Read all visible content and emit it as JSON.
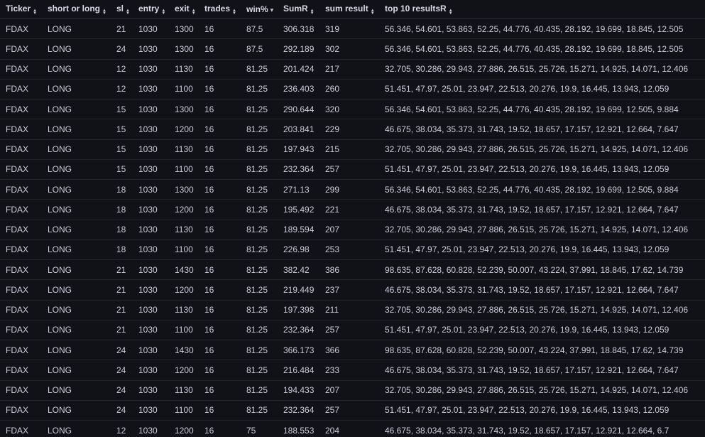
{
  "columns": [
    {
      "label": "Ticker",
      "sort_icon": "sort-both-icon",
      "sorted": false
    },
    {
      "label": "short or long",
      "sort_icon": "sort-both-icon",
      "sorted": false
    },
    {
      "label": "sl",
      "sort_icon": "sort-both-icon",
      "sorted": false
    },
    {
      "label": "entry",
      "sort_icon": "sort-both-icon",
      "sorted": false
    },
    {
      "label": "exit",
      "sort_icon": "sort-both-icon",
      "sorted": false
    },
    {
      "label": "trades",
      "sort_icon": "sort-both-icon",
      "sorted": false
    },
    {
      "label": "win%",
      "sort_icon": "sort-descending-icon",
      "sorted": true
    },
    {
      "label": "SumR",
      "sort_icon": "sort-both-icon",
      "sorted": false
    },
    {
      "label": "sum result",
      "sort_icon": "sort-both-icon",
      "sorted": false
    },
    {
      "label": "top 10 resultsR",
      "sort_icon": "sort-both-icon",
      "sorted": false
    }
  ],
  "rows": [
    [
      "FDAX",
      "LONG",
      "21",
      "1030",
      "1300",
      "16",
      "87.5",
      "306.318",
      "319",
      "56.346, 54.601, 53.863, 52.25, 44.776, 40.435, 28.192, 19.699, 18.845, 12.505"
    ],
    [
      "FDAX",
      "LONG",
      "24",
      "1030",
      "1300",
      "16",
      "87.5",
      "292.189",
      "302",
      "56.346, 54.601, 53.863, 52.25, 44.776, 40.435, 28.192, 19.699, 18.845, 12.505"
    ],
    [
      "FDAX",
      "LONG",
      "12",
      "1030",
      "1130",
      "16",
      "81.25",
      "201.424",
      "217",
      "32.705, 30.286, 29.943, 27.886, 26.515, 25.726, 15.271, 14.925, 14.071, 12.406"
    ],
    [
      "FDAX",
      "LONG",
      "12",
      "1030",
      "1100",
      "16",
      "81.25",
      "236.403",
      "260",
      "51.451, 47.97, 25.01, 23.947, 22.513, 20.276, 19.9, 16.445, 13.943, 12.059"
    ],
    [
      "FDAX",
      "LONG",
      "15",
      "1030",
      "1300",
      "16",
      "81.25",
      "290.644",
      "320",
      "56.346, 54.601, 53.863, 52.25, 44.776, 40.435, 28.192, 19.699, 12.505, 9.884"
    ],
    [
      "FDAX",
      "LONG",
      "15",
      "1030",
      "1200",
      "16",
      "81.25",
      "203.841",
      "229",
      "46.675, 38.034, 35.373, 31.743, 19.52, 18.657, 17.157, 12.921, 12.664, 7.647"
    ],
    [
      "FDAX",
      "LONG",
      "15",
      "1030",
      "1130",
      "16",
      "81.25",
      "197.943",
      "215",
      "32.705, 30.286, 29.943, 27.886, 26.515, 25.726, 15.271, 14.925, 14.071, 12.406"
    ],
    [
      "FDAX",
      "LONG",
      "15",
      "1030",
      "1100",
      "16",
      "81.25",
      "232.364",
      "257",
      "51.451, 47.97, 25.01, 23.947, 22.513, 20.276, 19.9, 16.445, 13.943, 12.059"
    ],
    [
      "FDAX",
      "LONG",
      "18",
      "1030",
      "1300",
      "16",
      "81.25",
      "271.13",
      "299",
      "56.346, 54.601, 53.863, 52.25, 44.776, 40.435, 28.192, 19.699, 12.505, 9.884"
    ],
    [
      "FDAX",
      "LONG",
      "18",
      "1030",
      "1200",
      "16",
      "81.25",
      "195.492",
      "221",
      "46.675, 38.034, 35.373, 31.743, 19.52, 18.657, 17.157, 12.921, 12.664, 7.647"
    ],
    [
      "FDAX",
      "LONG",
      "18",
      "1030",
      "1130",
      "16",
      "81.25",
      "189.594",
      "207",
      "32.705, 30.286, 29.943, 27.886, 26.515, 25.726, 15.271, 14.925, 14.071, 12.406"
    ],
    [
      "FDAX",
      "LONG",
      "18",
      "1030",
      "1100",
      "16",
      "81.25",
      "226.98",
      "253",
      "51.451, 47.97, 25.01, 23.947, 22.513, 20.276, 19.9, 16.445, 13.943, 12.059"
    ],
    [
      "FDAX",
      "LONG",
      "21",
      "1030",
      "1430",
      "16",
      "81.25",
      "382.42",
      "386",
      "98.635, 87.628, 60.828, 52.239, 50.007, 43.224, 37.991, 18.845, 17.62, 14.739"
    ],
    [
      "FDAX",
      "LONG",
      "21",
      "1030",
      "1200",
      "16",
      "81.25",
      "219.449",
      "237",
      "46.675, 38.034, 35.373, 31.743, 19.52, 18.657, 17.157, 12.921, 12.664, 7.647"
    ],
    [
      "FDAX",
      "LONG",
      "21",
      "1030",
      "1130",
      "16",
      "81.25",
      "197.398",
      "211",
      "32.705, 30.286, 29.943, 27.886, 26.515, 25.726, 15.271, 14.925, 14.071, 12.406"
    ],
    [
      "FDAX",
      "LONG",
      "21",
      "1030",
      "1100",
      "16",
      "81.25",
      "232.364",
      "257",
      "51.451, 47.97, 25.01, 23.947, 22.513, 20.276, 19.9, 16.445, 13.943, 12.059"
    ],
    [
      "FDAX",
      "LONG",
      "24",
      "1030",
      "1430",
      "16",
      "81.25",
      "366.173",
      "366",
      "98.635, 87.628, 60.828, 52.239, 50.007, 43.224, 37.991, 18.845, 17.62, 14.739"
    ],
    [
      "FDAX",
      "LONG",
      "24",
      "1030",
      "1200",
      "16",
      "81.25",
      "216.484",
      "233",
      "46.675, 38.034, 35.373, 31.743, 19.52, 18.657, 17.157, 12.921, 12.664, 7.647"
    ],
    [
      "FDAX",
      "LONG",
      "24",
      "1030",
      "1130",
      "16",
      "81.25",
      "194.433",
      "207",
      "32.705, 30.286, 29.943, 27.886, 26.515, 25.726, 15.271, 14.925, 14.071, 12.406"
    ],
    [
      "FDAX",
      "LONG",
      "24",
      "1030",
      "1100",
      "16",
      "81.25",
      "232.364",
      "257",
      "51.451, 47.97, 25.01, 23.947, 22.513, 20.276, 19.9, 16.445, 13.943, 12.059"
    ],
    [
      "FDAX",
      "LONG",
      "12",
      "1030",
      "1200",
      "16",
      "75",
      "188.553",
      "204",
      "46.675, 38.034, 35.373, 31.743, 19.52, 18.657, 17.157, 12.921, 12.664, 6.7"
    ]
  ],
  "colors": {
    "background": "#111217",
    "text": "#ccccdc",
    "header_text": "#d8d9e6",
    "row_border": "#24262c"
  }
}
